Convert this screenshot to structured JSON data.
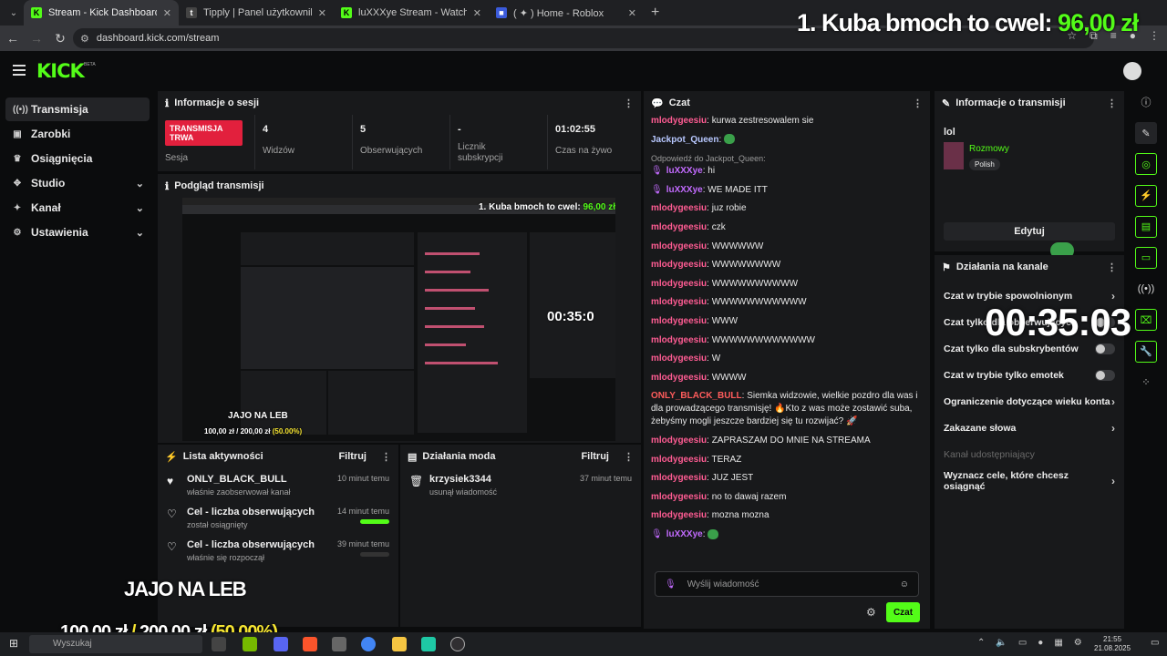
{
  "browser": {
    "tabs": [
      {
        "title": "Stream - Kick Dashboard",
        "active": true,
        "favicon": "kick-icon",
        "color": "#53fc18"
      },
      {
        "title": "Tipply | Panel użytkownika",
        "active": false,
        "favicon": "tipply-icon",
        "color": "#444"
      },
      {
        "title": "luXXXye Stream - Watch Live o",
        "active": false,
        "favicon": "kick-icon",
        "color": "#53fc18"
      },
      {
        "title": "( ✦ ) Home - Roblox",
        "active": false,
        "favicon": "roblox-icon",
        "color": "#3b5bdb"
      }
    ],
    "url": "dashboard.kick.com/stream"
  },
  "overlay": {
    "top_rank": "1. Kuba bmoch to cwel: ",
    "top_amount": "96,00 zł",
    "timer": "00:35:03",
    "title": "JAJO NA LEB",
    "goal_current": "100,00 zł",
    "goal_sep": " / ",
    "goal_target": "200,00 zł",
    "goal_percent": " (50.00%)"
  },
  "kick": {
    "logo": "KICK",
    "beta": "BETA",
    "accent": "#53fc18"
  },
  "sidebar": {
    "items": [
      {
        "label": "Transmisja",
        "icon": "broadcast-icon",
        "active": true,
        "expandable": false
      },
      {
        "label": "Zarobki",
        "icon": "earnings-icon",
        "active": false,
        "expandable": false
      },
      {
        "label": "Osiągnięcia",
        "icon": "trophy-icon",
        "active": false,
        "expandable": false
      },
      {
        "label": "Studio",
        "icon": "studio-icon",
        "active": false,
        "expandable": true
      },
      {
        "label": "Kanał",
        "icon": "channel-icon",
        "active": false,
        "expandable": true
      },
      {
        "label": "Ustawienia",
        "icon": "settings-icon",
        "active": false,
        "expandable": true
      }
    ]
  },
  "session": {
    "title": "Informacje o sesji",
    "live_badge": "TRANSMISJA TRWA",
    "live_sub": "Sesja",
    "stats": [
      {
        "value": "4",
        "label": "Widzów"
      },
      {
        "value": "5",
        "label": "Obserwujących"
      },
      {
        "value": "-",
        "label": "Licznik subskrypcji"
      },
      {
        "value": "01:02:55",
        "label": "Czas na żywo"
      }
    ]
  },
  "preview": {
    "title": "Podgląd transmisji",
    "mini_rank": "1. Kuba bmoch to cwel: ",
    "mini_amount": "96,00 zł",
    "mini_timer": "00:35:0",
    "mini_title": "JAJO NA LEB",
    "mini_goal": "100,00 zł / 200,00 zł ",
    "mini_goal_pct": "(50.00%)"
  },
  "activity": {
    "title": "Lista aktywności",
    "filter": "Filtruj",
    "items": [
      {
        "icon": "heart-filled-icon",
        "title": "ONLY_BLACK_BULL",
        "sub": "właśnie zaobserwował kanał",
        "time": "10 minut temu",
        "progress": null
      },
      {
        "icon": "heart-outline-icon",
        "title": "Cel - liczba obserwujących",
        "sub": "został osiągnięty",
        "time": "14 minut temu",
        "progress": 1.0
      },
      {
        "icon": "heart-outline-icon",
        "title": "Cel - liczba obserwujących",
        "sub": "właśnie się rozpoczął",
        "time": "39 minut temu",
        "progress": 0.0
      }
    ]
  },
  "mod": {
    "title": "Działania moda",
    "filter": "Filtruj",
    "items": [
      {
        "icon": "trash-icon",
        "title": "krzysiek3344",
        "sub": "usunął wiadomość",
        "time": "37 minut temu"
      }
    ]
  },
  "chat": {
    "title": "Czat",
    "messages": [
      {
        "user": "mlodygeesiu",
        "color": "#ff5c93",
        "text": "kurwa zestresowalem sie"
      },
      {
        "user": "Jackpot_Queen",
        "color": "#b8c8ff",
        "text": "",
        "emote": true
      },
      {
        "reply_to": "Odpowiedź do Jackpot_Queen:",
        "user": "luXXXye",
        "color": "#c36bff",
        "text": "hi",
        "badge": true
      },
      {
        "user": "luXXXye",
        "color": "#c36bff",
        "text": "WE MADE ITT",
        "badge": true
      },
      {
        "user": "mlodygeesiu",
        "color": "#ff5c93",
        "text": "juz robie"
      },
      {
        "user": "mlodygeesiu",
        "color": "#ff5c93",
        "text": "czk"
      },
      {
        "user": "mlodygeesiu",
        "color": "#ff5c93",
        "text": "WWWWWW"
      },
      {
        "user": "mlodygeesiu",
        "color": "#ff5c93",
        "text": "WWWWWWWW"
      },
      {
        "user": "mlodygeesiu",
        "color": "#ff5c93",
        "text": "WWWWWWWWWW"
      },
      {
        "user": "mlodygeesiu",
        "color": "#ff5c93",
        "text": "WWWWWWWWWWW"
      },
      {
        "user": "mlodygeesiu",
        "color": "#ff5c93",
        "text": "WWW"
      },
      {
        "user": "mlodygeesiu",
        "color": "#ff5c93",
        "text": "WWWWWWWWWWWW"
      },
      {
        "user": "mlodygeesiu",
        "color": "#ff5c93",
        "text": "W"
      },
      {
        "user": "mlodygeesiu",
        "color": "#ff5c93",
        "text": "WWWW"
      },
      {
        "user": "ONLY_BLACK_BULL",
        "color": "#ff5c5c",
        "text": "Siemka widzowie, wielkie pozdro dla was i dla prowadzącego transmisję! 🔥Kto z was może zostawić suba, żebyśmy mogli jeszcze bardziej się tu rozwijać? 🚀"
      },
      {
        "user": "mlodygeesiu",
        "color": "#ff5c93",
        "text": "ZAPRASZAM DO MNIE NA STREAMA"
      },
      {
        "user": "mlodygeesiu",
        "color": "#ff5c93",
        "text": "TERAZ"
      },
      {
        "user": "mlodygeesiu",
        "color": "#ff5c93",
        "text": "JUZ JEST"
      },
      {
        "user": "mlodygeesiu",
        "color": "#ff5c93",
        "text": "no to dawaj razem"
      },
      {
        "user": "mlodygeesiu",
        "color": "#ff5c93",
        "text": "mozna mozna"
      },
      {
        "user": "luXXXye",
        "color": "#c36bff",
        "text": "",
        "badge": true,
        "emote": true
      }
    ],
    "input_placeholder": "Wyślij wiadomość",
    "send_label": "Czat"
  },
  "stream_info": {
    "title": "Informacje o transmisji",
    "stream_title": "lol",
    "category": "Rozmowy",
    "tag": "Polish",
    "edit_label": "Edytuj"
  },
  "channel_actions": {
    "title": "Działania na kanale",
    "items": [
      {
        "label": "Czat w trybie spowolnionym",
        "kind": "chevron"
      },
      {
        "label": "Czat tylko dla obserwujących",
        "kind": "toggle"
      },
      {
        "label": "Czat tylko dla subskrybentów",
        "kind": "toggle"
      },
      {
        "label": "Czat w trybie tylko emotek",
        "kind": "toggle"
      },
      {
        "label": "Ograniczenie dotyczące wieku konta",
        "kind": "chevron"
      },
      {
        "label": "Zakazane słowa",
        "kind": "chevron"
      },
      {
        "label": "Kanał udostępniający",
        "kind": "disabled"
      },
      {
        "label": "Wyznacz cele, które chcesz osiągnąć",
        "kind": "chevron"
      }
    ]
  },
  "taskbar": {
    "search_placeholder": "Wyszukaj",
    "time": "21:55",
    "date": "21.08.2025"
  }
}
